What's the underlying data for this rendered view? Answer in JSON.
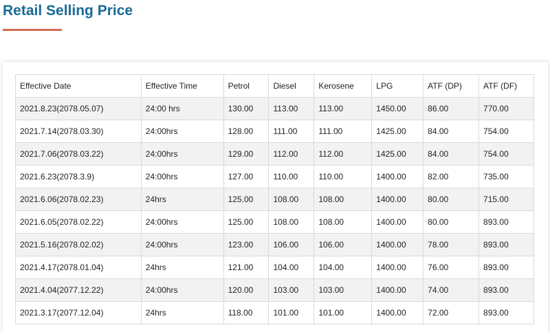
{
  "page": {
    "title": "Retail Selling Price"
  },
  "table": {
    "headers": [
      "Effective Date",
      "Effective Time",
      "Petrol",
      "Diesel",
      "Kerosene",
      "LPG",
      "ATF (DP)",
      "ATF (DF)"
    ],
    "rows": [
      [
        "2021.8.23(2078.05.07)",
        "24:00 hrs",
        "130.00",
        "113.00",
        "113.00",
        "1450.00",
        "86.00",
        "770.00"
      ],
      [
        "2021.7.14(2078.03.30)",
        "24:00hrs",
        "128.00",
        "111.00",
        "111.00",
        "1425.00",
        "84.00",
        "754.00"
      ],
      [
        "2021.7.06(2078.03.22)",
        "24:00hrs",
        "129.00",
        "112.00",
        "112.00",
        "1425.00",
        "84.00",
        "754.00"
      ],
      [
        "2021.6.23(2078.3.9)",
        "24:00hrs",
        "127.00",
        "110.00",
        "110.00",
        "1400.00",
        "82.00",
        "735.00"
      ],
      [
        "2021.6.06(2078.02.23)",
        "24hrs",
        "125.00",
        "108.00",
        "108.00",
        "1400.00",
        "80.00",
        "715.00"
      ],
      [
        "2021.6.05(2078.02.22)",
        "24:00hrs",
        "125.00",
        "108.00",
        "108.00",
        "1400.00",
        "80.00",
        "893.00"
      ],
      [
        "2021.5.16(2078.02.02)",
        "24:00hrs",
        "123.00",
        "106.00",
        "106.00",
        "1400.00",
        "78.00",
        "893.00"
      ],
      [
        "2021.4.17(2078.01.04)",
        "24hrs",
        "121.00",
        "104.00",
        "104.00",
        "1400.00",
        "76.00",
        "893.00"
      ],
      [
        "2021.4.04(2077.12.22)",
        "24:00hrs",
        "120.00",
        "103.00",
        "103.00",
        "1400.00",
        "74.00",
        "893.00"
      ],
      [
        "2021.3.17(2077.12.04)",
        "24hrs",
        "118.00",
        "101.00",
        "101.00",
        "1400.00",
        "72.00",
        "893.00"
      ]
    ]
  },
  "colors": {
    "title": "#1a6a96",
    "accent_underline": "#d6694f",
    "row_stripe": "#f2f2f2",
    "border": "#d9d9d9"
  }
}
